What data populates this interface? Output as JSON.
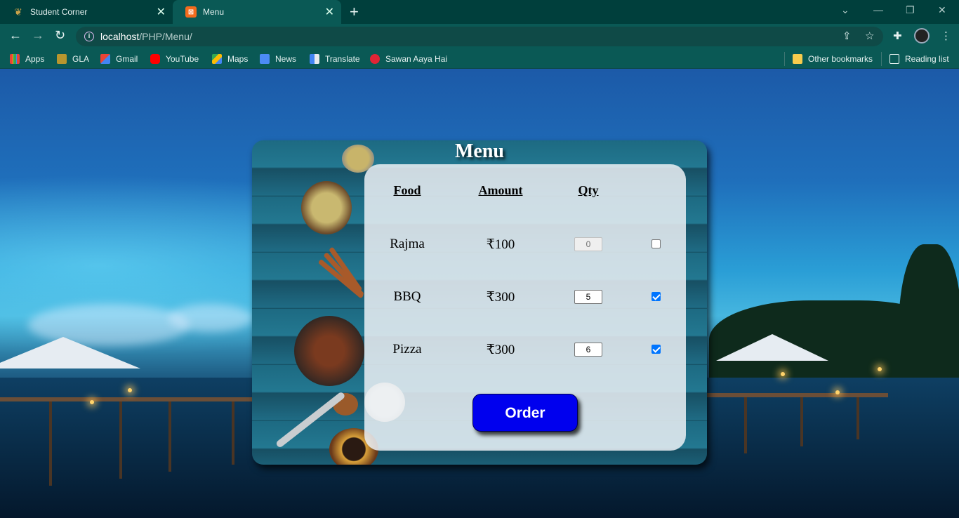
{
  "browser": {
    "tabs": [
      {
        "title": "Student Corner",
        "active": false
      },
      {
        "title": "Menu",
        "active": true
      }
    ],
    "url_host": "localhost",
    "url_path": "/PHP/Menu/",
    "bookmarks": [
      {
        "label": "Apps",
        "icon": "apps-grid-icon"
      },
      {
        "label": "GLA",
        "icon": "gla-icon"
      },
      {
        "label": "Gmail",
        "icon": "gmail-icon"
      },
      {
        "label": "YouTube",
        "icon": "youtube-icon"
      },
      {
        "label": "Maps",
        "icon": "maps-icon"
      },
      {
        "label": "News",
        "icon": "news-icon"
      },
      {
        "label": "Translate",
        "icon": "translate-icon"
      },
      {
        "label": "Sawan Aaya Hai",
        "icon": "music-icon"
      }
    ],
    "other_bookmarks": "Other bookmarks",
    "reading_list": "Reading list"
  },
  "menu": {
    "title": "Menu",
    "headers": {
      "food": "Food",
      "amount": "Amount",
      "qty": "Qty"
    },
    "items": [
      {
        "food": "Rajma",
        "amount": "₹100",
        "qty": "0",
        "checked": false
      },
      {
        "food": "BBQ",
        "amount": "₹300",
        "qty": "5",
        "checked": true
      },
      {
        "food": "Pizza",
        "amount": "₹300",
        "qty": "6",
        "checked": true
      }
    ],
    "order_label": "Order"
  },
  "colors": {
    "chrome_dark": "#003f3c",
    "chrome": "#0a5955",
    "order_button": "#0000ee",
    "checkbox_on": "#0075ff"
  }
}
